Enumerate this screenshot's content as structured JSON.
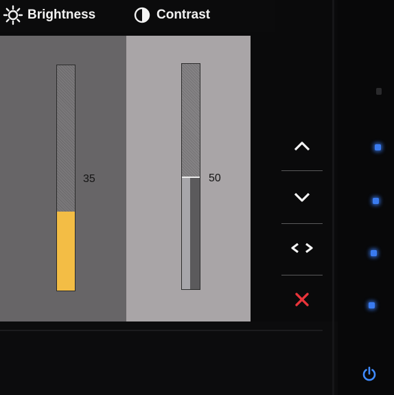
{
  "osd": {
    "brightness": {
      "label": "Brightness",
      "value": "35",
      "level": 35,
      "icon": "sun-icon"
    },
    "contrast": {
      "label": "Contrast",
      "value": "50",
      "level": 50,
      "icon": "contrast-icon"
    }
  },
  "colors": {
    "brightness_fill": "#f3bd45",
    "contrast_fill": "#5b5a5c",
    "close_red": "#e8343a",
    "led_blue": "#3a7bf0"
  },
  "buttons": [
    "up-arrow-icon",
    "down-arrow-icon",
    "left-right-arrows-icon",
    "close-icon",
    "power-icon"
  ]
}
